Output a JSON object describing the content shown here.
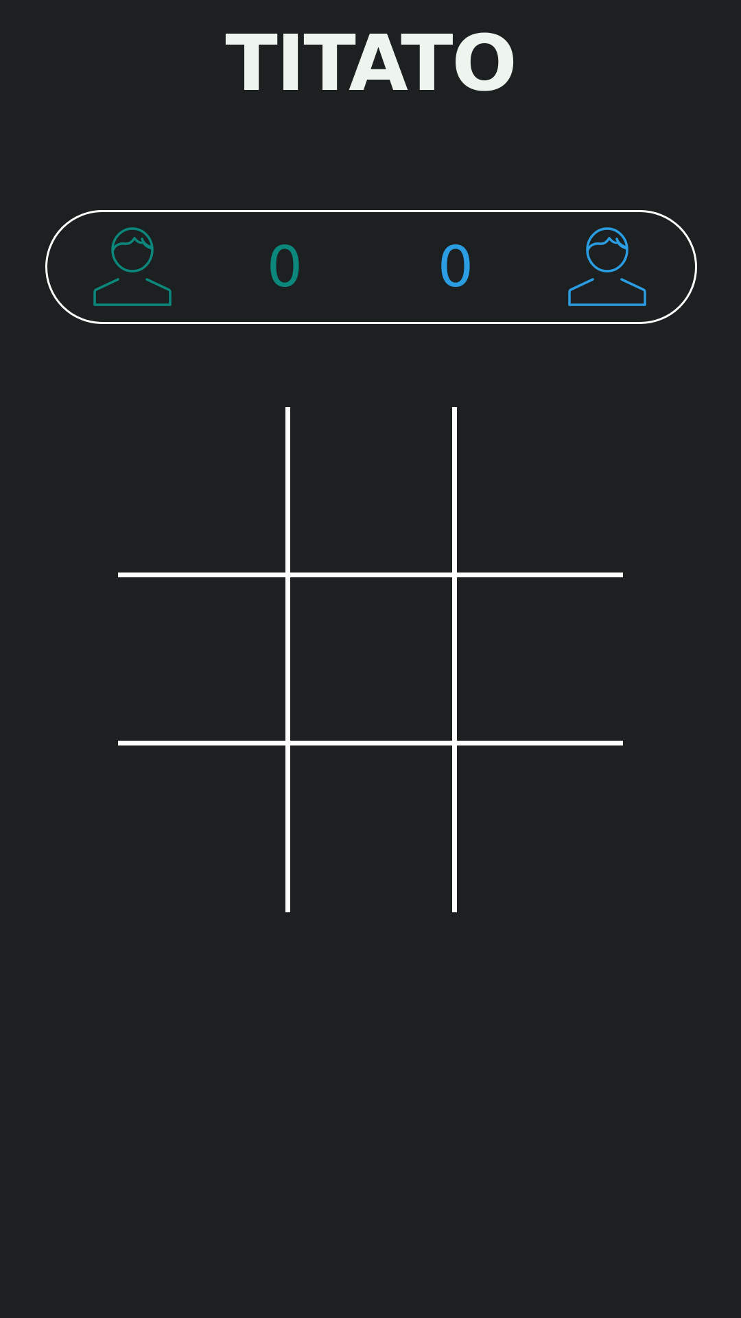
{
  "app": {
    "title": "TITATO"
  },
  "scoreboard": {
    "player1": {
      "icon": "user-icon",
      "score": "0",
      "color": "#0b877c"
    },
    "player2": {
      "icon": "user-icon",
      "score": "0",
      "color": "#2a9de3"
    }
  },
  "colors": {
    "background": "#1c2021",
    "title": "#eef4ee",
    "board_lines": "#ffffff"
  },
  "board": {
    "cells": [
      "",
      "",
      "",
      "",
      "",
      "",
      "",
      "",
      ""
    ]
  }
}
